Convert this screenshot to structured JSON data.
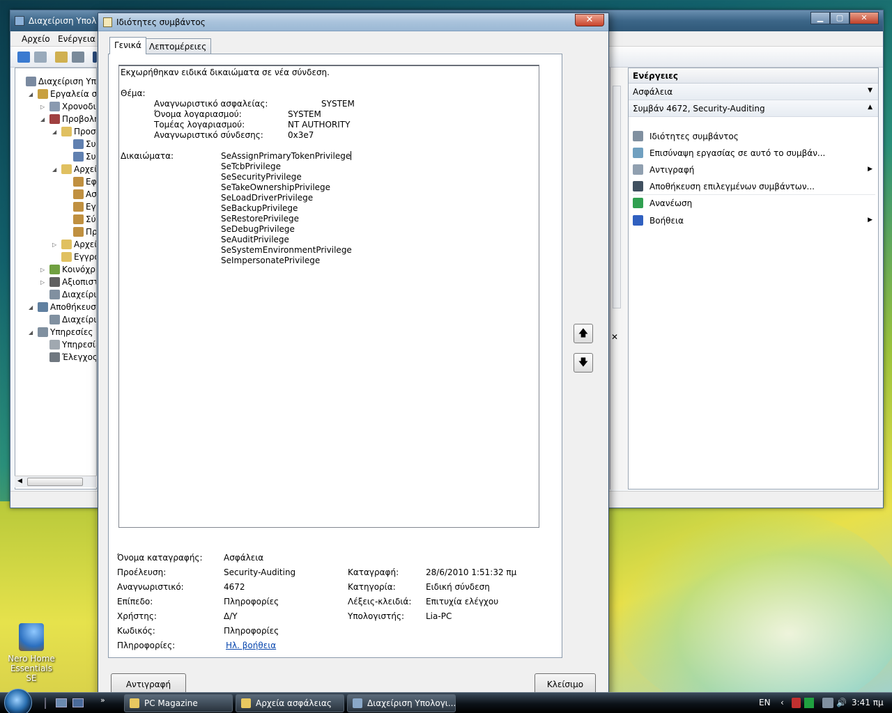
{
  "mmc": {
    "title": "Διαχείριση Υπολ",
    "menu": [
      "Αρχείο",
      "Ενέργεια"
    ],
    "tree": [
      {
        "label": "Διαχείριση Υπολ",
        "level": 0,
        "exp": "",
        "color": "#7a8aa0"
      },
      {
        "label": "Εργαλεία συσ",
        "level": 1,
        "exp": "◢",
        "color": "#c8a040"
      },
      {
        "label": "Χρονοδιά",
        "level": 2,
        "exp": "▷",
        "color": "#8a9ab0"
      },
      {
        "label": "Προβολή",
        "level": 2,
        "exp": "◢",
        "color": "#a04040"
      },
      {
        "label": "Προσα",
        "level": 3,
        "exp": "◢",
        "color": "#e0c060"
      },
      {
        "label": "Συ",
        "level": 4,
        "exp": "",
        "color": "#6080b0"
      },
      {
        "label": "Συ",
        "level": 4,
        "exp": "",
        "color": "#6080b0"
      },
      {
        "label": "Αρχεία",
        "level": 3,
        "exp": "◢",
        "color": "#e0c060"
      },
      {
        "label": "Εφ",
        "level": 4,
        "exp": "",
        "color": "#c09040"
      },
      {
        "label": "Ασ",
        "level": 4,
        "exp": "",
        "color": "#c09040"
      },
      {
        "label": "Εγ",
        "level": 4,
        "exp": "",
        "color": "#c09040"
      },
      {
        "label": "Σύ",
        "level": 4,
        "exp": "",
        "color": "#c09040"
      },
      {
        "label": "Πρ",
        "level": 4,
        "exp": "",
        "color": "#c09040"
      },
      {
        "label": "Αρχεία",
        "level": 3,
        "exp": "▷",
        "color": "#e0c060"
      },
      {
        "label": "Εγγρα",
        "level": 3,
        "exp": "",
        "color": "#e0c060"
      },
      {
        "label": "Κοινόχρη",
        "level": 2,
        "exp": "▷",
        "color": "#70a040"
      },
      {
        "label": "Αξιοπιστ",
        "level": 2,
        "exp": "▷",
        "color": "#606060"
      },
      {
        "label": "Διαχείρισ",
        "level": 2,
        "exp": "",
        "color": "#8090a0"
      },
      {
        "label": "Αποθήκευση",
        "level": 1,
        "exp": "◢",
        "color": "#6080a0"
      },
      {
        "label": "Διαχείρισ",
        "level": 2,
        "exp": "",
        "color": "#8090a0"
      },
      {
        "label": "Υπηρεσίες κα",
        "level": 1,
        "exp": "◢",
        "color": "#8090a0"
      },
      {
        "label": "Υπηρεσίε",
        "level": 2,
        "exp": "",
        "color": "#a0a8b0"
      },
      {
        "label": "Έλεγχος ο",
        "level": 2,
        "exp": "",
        "color": "#707880"
      }
    ],
    "actions": {
      "header": "Ενέργειες",
      "section1": "Ασφάλεια",
      "section2": "Συμβάν 4672, Security-Auditing",
      "items": [
        {
          "label": "Ιδιότητες συμβάντος",
          "icon": "properties-icon",
          "submenu": false
        },
        {
          "label": "Επισύναψη εργασίας σε αυτό το συμβάν...",
          "icon": "attach-task-icon",
          "submenu": false
        },
        {
          "label": "Αντιγραφή",
          "icon": "copy-icon",
          "submenu": true
        },
        {
          "label": "Αποθήκευση επιλεγμένων συμβάντων...",
          "icon": "save-icon",
          "submenu": false
        },
        {
          "label": "Ανανέωση",
          "icon": "refresh-icon",
          "submenu": false
        },
        {
          "label": "Βοήθεια",
          "icon": "help-icon",
          "submenu": true
        }
      ]
    }
  },
  "dialog": {
    "title": "Ιδιότητες συμβάντος",
    "tabs": [
      "Γενικά",
      "Λεπτομέρειες"
    ],
    "description": {
      "summary": "Εκχωρήθηκαν ειδικά δικαιώματα σε νέα σύνδεση.",
      "subject_label": "Θέμα:",
      "subject": [
        {
          "label": "Αναγνωριστικό ασφαλείας:",
          "value": "SYSTEM"
        },
        {
          "label": "Όνομα λογαριασμού:",
          "value": "SYSTEM"
        },
        {
          "label": "Τομέας λογαριασμού:",
          "value": "NT AUTHORITY"
        },
        {
          "label": "Αναγνωριστικό σύνδεσης:",
          "value": "0x3e7"
        }
      ],
      "privileges_label": "Δικαιώματα:",
      "privileges": [
        "SeAssignPrimaryTokenPrivilege",
        "SeTcbPrivilege",
        "SeSecurityPrivilege",
        "SeTakeOwnershipPrivilege",
        "SeLoadDriverPrivilege",
        "SeBackupPrivilege",
        "SeRestorePrivilege",
        "SeDebugPrivilege",
        "SeAuditPrivilege",
        "SeSystemEnvironmentPrivilege",
        "SeImpersonatePrivilege"
      ]
    },
    "fields": {
      "log_name_label": "Όνομα καταγραφής:",
      "log_name": "Ασφάλεια",
      "source_label": "Προέλευση:",
      "source": "Security-Auditing",
      "logged_label": "Καταγραφή:",
      "logged": "28/6/2010 1:51:32 πμ",
      "event_id_label": "Αναγνωριστικό:",
      "event_id": "4672",
      "category_label": "Κατηγορία:",
      "category": "Ειδική σύνδεση",
      "level_label": "Επίπεδο:",
      "level": "Πληροφορίες",
      "keywords_label": "Λέξεις-κλειδιά:",
      "keywords": "Επιτυχία ελέγχου",
      "user_label": "Χρήστης:",
      "user": "Δ/Υ",
      "computer_label": "Υπολογιστής:",
      "computer": "Lia-PC",
      "opcode_label": "Κωδικός:",
      "opcode": "Πληροφορίες",
      "info_label": "Πληροφορίες:",
      "info_link": "Ηλ. βοήθεια"
    },
    "copy_button": "Αντιγραφή",
    "close_button": "Κλείσιμο"
  },
  "desktop_icon": {
    "line1": "Nero Home",
    "line2": "Essentials SE"
  },
  "taskbar": {
    "tasks": [
      "PC Magazine",
      "Αρχεία ασφάλειας",
      "Διαχείριση Υπολογι..."
    ],
    "language": "EN",
    "clock": "3:41 πμ"
  }
}
